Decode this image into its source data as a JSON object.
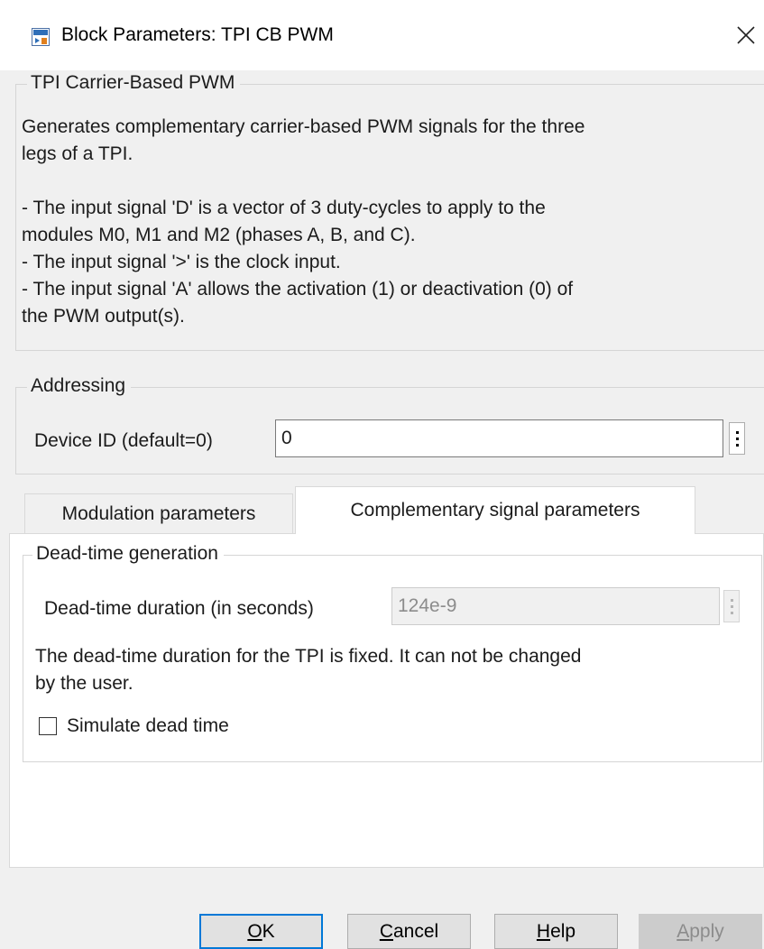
{
  "window": {
    "title": "Block Parameters: TPI CB PWM",
    "icon": "simulink-block-icon",
    "close_icon": "close-icon"
  },
  "description_group": {
    "legend": "TPI Carrier-Based PWM",
    "text": "Generates complementary carrier-based PWM signals for the three\nlegs of a TPI.\n\n- The input signal 'D' is a vector of 3 duty-cycles to apply to the\nmodules M0, M1 and M2 (phases A, B, and C).\n- The input signal '>' is the clock input.\n- The input signal 'A' allows the activation (1) or deactivation (0) of\nthe PWM output(s)."
  },
  "addressing": {
    "legend": "Addressing",
    "device_id_label": "Device ID (default=0)",
    "device_id_value": "0"
  },
  "tabs": [
    {
      "label": "Modulation parameters",
      "active": false
    },
    {
      "label": "Complementary signal parameters",
      "active": true
    }
  ],
  "dead_time": {
    "legend": "Dead-time generation",
    "duration_label": "Dead-time duration (in seconds)",
    "duration_value": "124e-9",
    "note": "The dead-time duration for the TPI is fixed. It can not be changed\nby the user.",
    "simulate_label": "Simulate dead time",
    "simulate_checked": false
  },
  "buttons": {
    "ok": {
      "mnemonic": "O",
      "rest": "K"
    },
    "cancel": {
      "mnemonic": "C",
      "rest": "ancel"
    },
    "help": {
      "mnemonic": "H",
      "rest": "elp"
    },
    "apply": {
      "mnemonic": "A",
      "rest": "pply"
    }
  },
  "colors": {
    "dialog_bg": "#f0f0f0",
    "default_button_border": "#0078d7"
  }
}
